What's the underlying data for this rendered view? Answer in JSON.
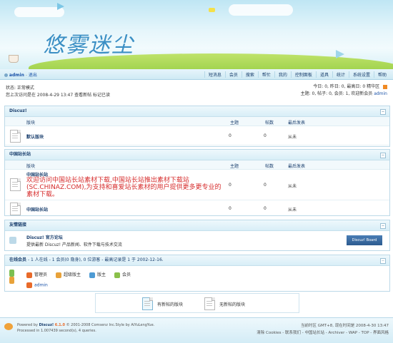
{
  "banner": {
    "logo_text": "悠雾迷尘"
  },
  "navbar": {
    "username": "admin",
    "logout": "退出",
    "menu": [
      "短消息",
      "会员",
      "搜索",
      "帮忙",
      "我的",
      "控制面板",
      "道具",
      "统计",
      "系统设置",
      "帮助"
    ]
  },
  "info": {
    "status": "状态: 正常模式",
    "last_visit": "您上次访问是在 2008-4-29 13:47 查看新帖 标记已读",
    "today": "今日: 0, 昨日: 0, 最高日: 0  精华区",
    "stats": "主题: 0, 帖子: 0, 会员: 1, 欢迎新会员",
    "new_member": "admin"
  },
  "columns": {
    "forum": "版块",
    "topics": "主题",
    "posts": "帖数",
    "last_post": "最后发表"
  },
  "section1": {
    "title": "Discuz!",
    "forums": [
      {
        "name": "默认版块",
        "topics": "0",
        "posts": "0",
        "last": "从未"
      }
    ]
  },
  "section2": {
    "title": "中国站长站",
    "forums": [
      {
        "name": "中国站长站",
        "desc": "欢迎访问中国站长站素材下载,中国站长站推出素材下载站(SC.CHINAZ.COM),为支持和喜爱站长素材的用户提供更多更专业的素材下载。",
        "topics": "0",
        "posts": "0",
        "last": "从未"
      },
      {
        "name": "中国站长站",
        "topics": "0",
        "posts": "0",
        "last": "从未"
      }
    ]
  },
  "links": {
    "title": "友情链接",
    "name": "Discuz! 官方论坛",
    "desc": "提供最新 Discuz! 产品新闻、软件下载与技术交流",
    "badge": "Discuz! Board"
  },
  "online": {
    "title": "在线会员",
    "summary": "- 1 人在线 - 1 会员(0 隐身), 0 位游客 - 最高记录是 1 于 2002-12-16.",
    "legend": [
      "管理员",
      "超级版主",
      "版主",
      "会员"
    ],
    "user": "admin"
  },
  "legend": {
    "new": "有新帖的版块",
    "nonew": "无新帖的版块"
  },
  "footer": {
    "powered_prefix": "Powered by",
    "powered_name": "Discuz!",
    "powered_version": "6.1.0",
    "powered_rest": "© 2001-2008 Comsenz Inc.Style by AiYuLengYue.",
    "processed": "Processed in 1.007439 second(s), 4 queries.",
    "timezone": "当前时区 GMT+8, 现在时间是 2008-4-30 13:47",
    "links": "清除 Cookies - 联系我们 - 中国站长站 - Archiver - WAP - TOP - 界面风格"
  }
}
